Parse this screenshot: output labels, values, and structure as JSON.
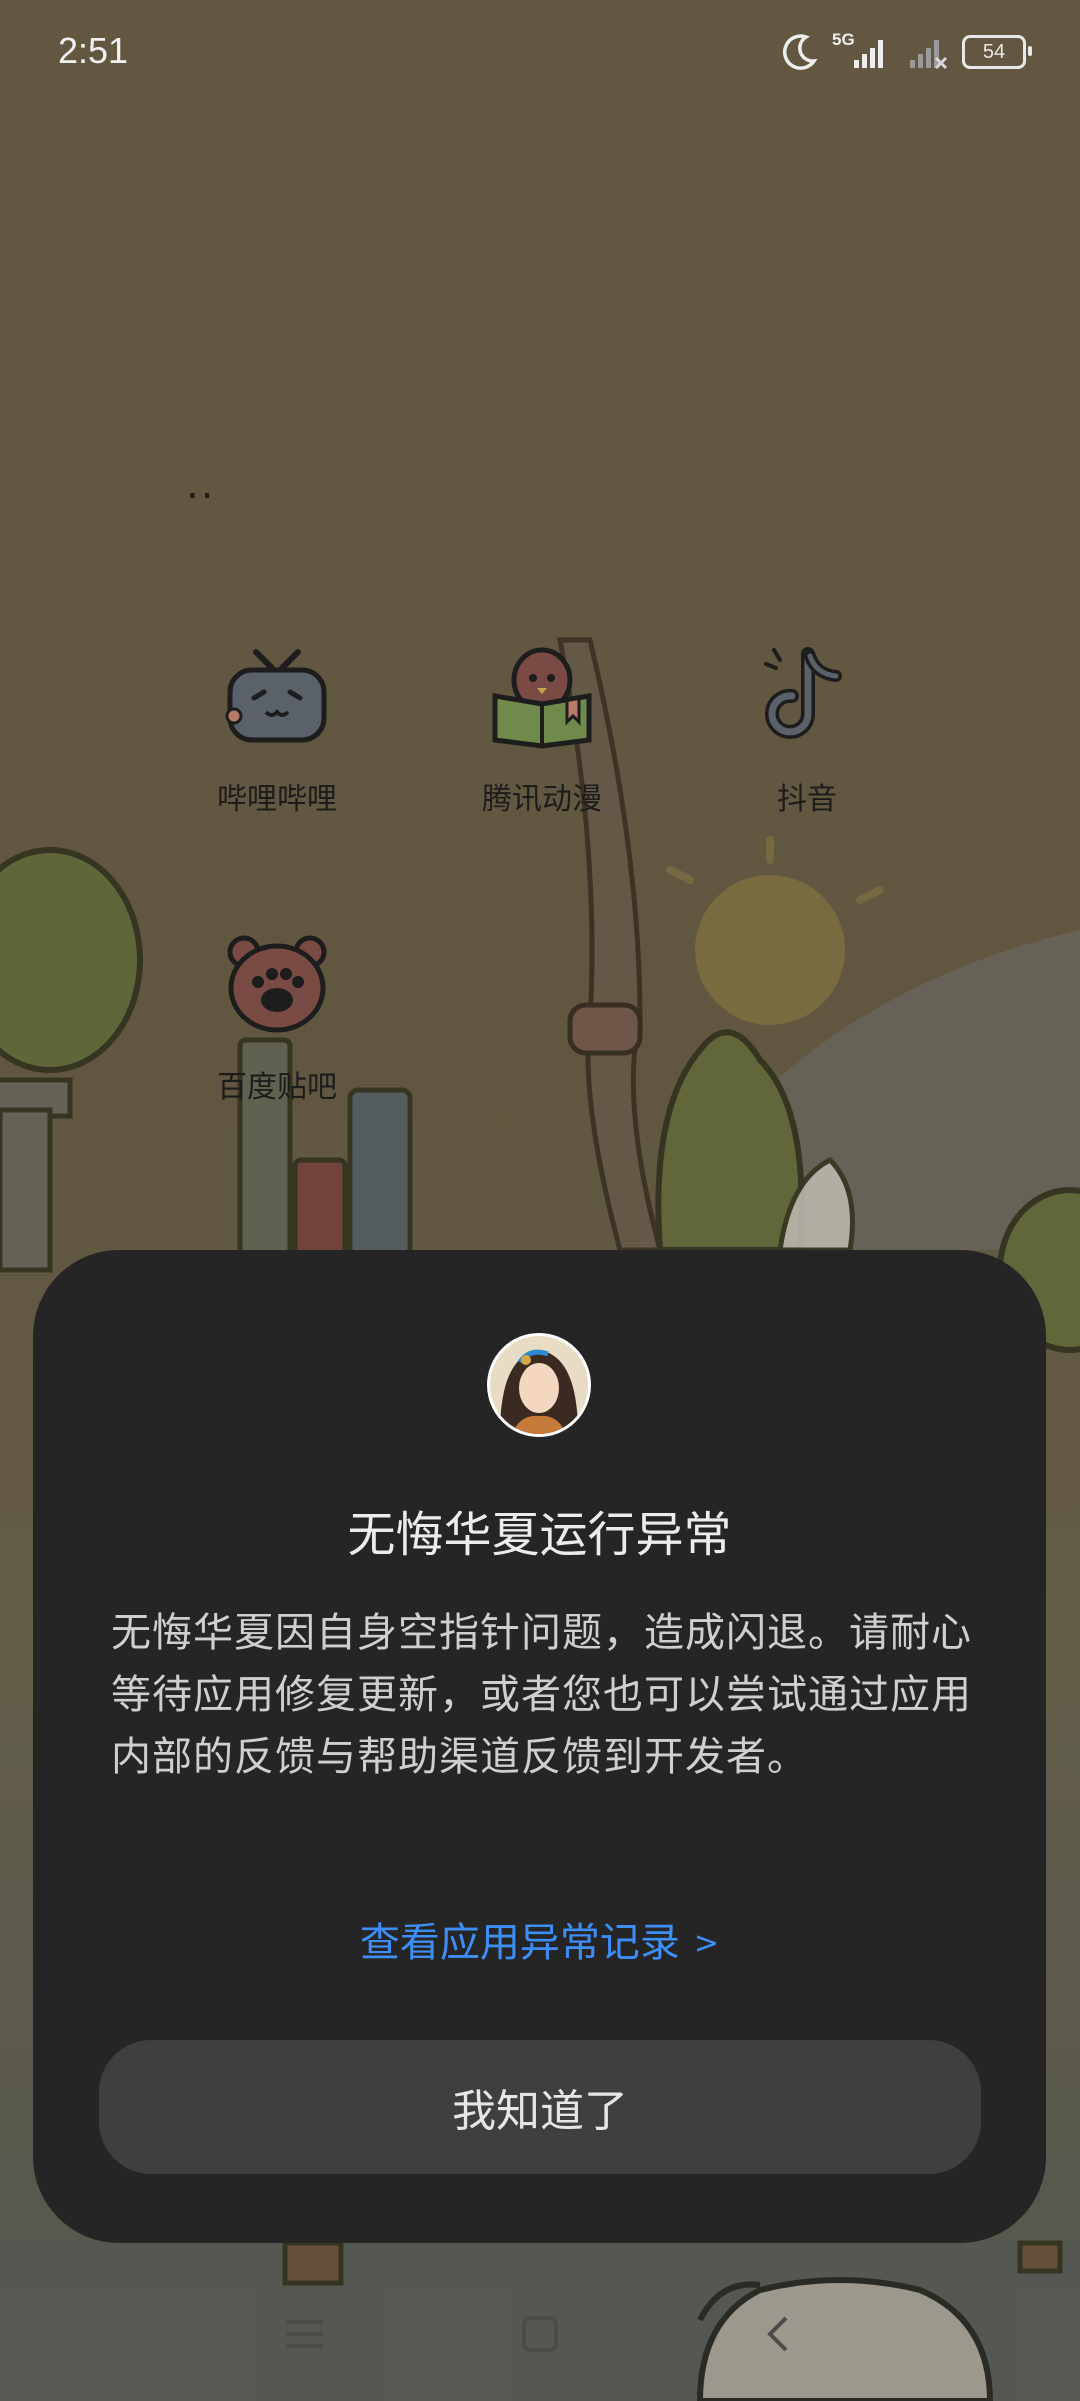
{
  "status_bar": {
    "time": "2:51",
    "network": "5G",
    "battery": "54"
  },
  "folder": {
    "title": ".."
  },
  "apps": [
    {
      "label": "哔哩哔哩",
      "icon": "bilibili-tv-icon"
    },
    {
      "label": "腾讯动漫",
      "icon": "penguin-reading-icon"
    },
    {
      "label": "抖音",
      "icon": "music-note-icon"
    },
    {
      "label": "百度贴吧",
      "icon": "bear-paw-icon"
    }
  ],
  "dialog": {
    "title": "无悔华夏运行异常",
    "body": "无悔华夏因自身空指针问题，造成闪退。请耐心等待应用修复更新，或者您也可以尝试通过应用内部的反馈与帮助渠道反馈到开发者。",
    "link": "查看应用异常记录",
    "link_chevron": ">",
    "button": "我知道了"
  },
  "colors": {
    "link": "#3e8ef7",
    "dialog_bg": "#252525",
    "button_bg": "#3f3f3f"
  }
}
